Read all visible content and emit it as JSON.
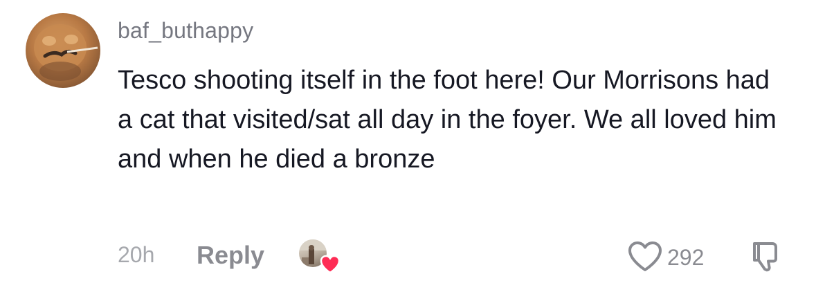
{
  "comment": {
    "username": "baf_buthappy",
    "text": "Tesco shooting itself in the foot here! Our Morrisons had a cat that visited/sat all day in the foyer. We all loved him and when he died a bronze",
    "timestamp": "20h",
    "reply_label": "Reply",
    "like_count": "292",
    "liked_by_creator": true,
    "avatar_icon": "cat-photo-avatar",
    "creator_avatar_icon": "creator-photo-avatar",
    "heart_color": "#fe2c55",
    "like_icon": "heart-outline-icon",
    "dislike_icon": "thumbs-down-outline-icon"
  }
}
